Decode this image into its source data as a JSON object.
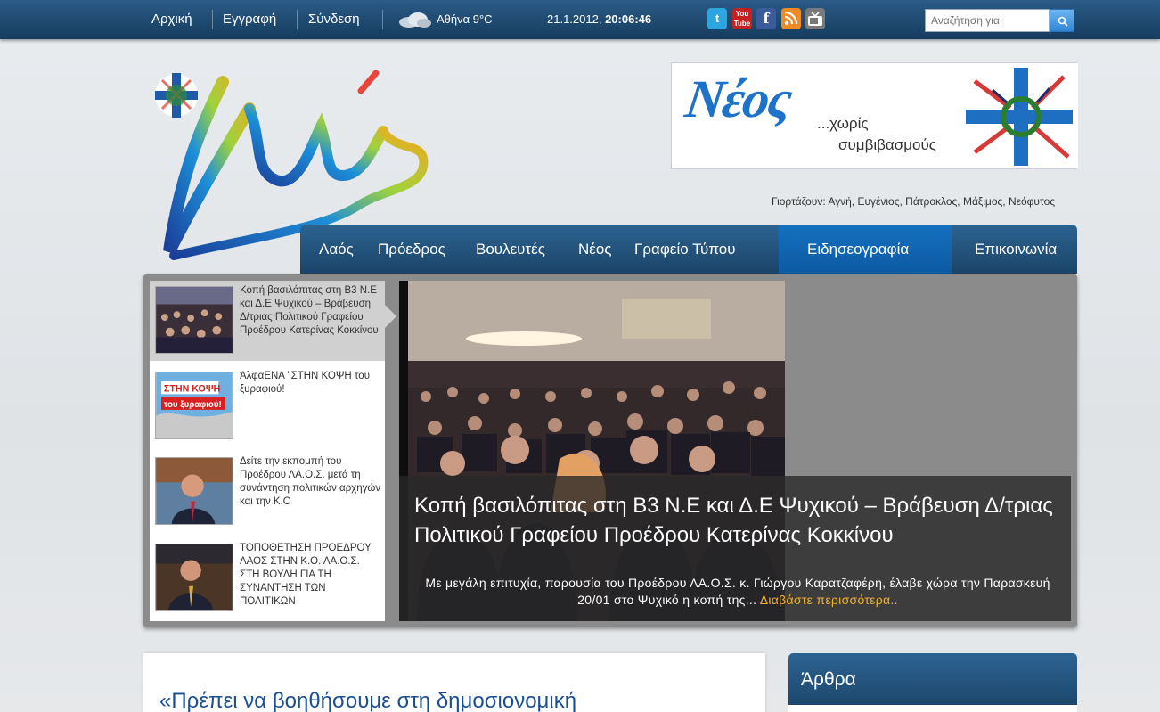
{
  "topbar": {
    "links": [
      "Αρχική",
      "Εγγραφή",
      "Σύνδεση"
    ],
    "weather": "Αθήνα 9°C",
    "date": "21.1.2012,",
    "time": "20:06:46",
    "social_icons": [
      "twitter-icon",
      "youtube-icon",
      "facebook-icon",
      "rss-icon",
      "tv-icon"
    ],
    "search_placeholder": "Αναζήτηση για:"
  },
  "banner": {
    "brand": "Νέος",
    "line1": "...χωρίς",
    "line2": "συμβιβασμούς"
  },
  "namedays": "Γιορτάζουν: Αγνή, Ευγένιος, Πάτροκλος, Μάξιμος, Νεόφυτος",
  "nav": {
    "items": [
      "Λαός",
      "Πρόεδρος",
      "Βουλευτές",
      "Νέος",
      "Γραφείο Τύπου",
      "Ειδησεογραφία",
      "Επικοινωνία"
    ],
    "active": "Ειδησεογραφία"
  },
  "slider": {
    "items": [
      {
        "title": "Κοπή βασιλόπιτας στη Β3 Ν.Ε και Δ.Ε Ψυχικού – Βράβευση Δ/τριας Πολιτικού Γραφείου Προέδρου Κατερίνας Κοκκίνου"
      },
      {
        "title": "ΆλφαΕΝΑ \"ΣΤΗΝ ΚΟΨΗ του ξυραφιού!"
      },
      {
        "title": "Δείτε την εκπομπή του Προέδρου ΛΑ.Ο.Σ. μετά τη συνάντηση πολιτικών αρχηγών και την Κ.Ο"
      },
      {
        "title": "ΤΟΠΟΘΕΤΗΣΗ ΠΡΟΕΔΡΟΥ ΛΑΟΣ ΣΤΗΝ Κ.Ο. ΛΑ.Ο.Σ. ΣΤΗ ΒΟΥΛΗ ΓΙΑ ΤΗ ΣΥΝΑΝΤΗΣΗ ΤΩΝ ΠΟΛΙΤΙΚΩΝ"
      }
    ],
    "thumb2_text": [
      "ΣΤΗΝ ΚΟΨΗ",
      "του ξυραφιού!"
    ],
    "caption_title": "Κοπή βασιλόπιτας στη Β3 Ν.Ε και Δ.Ε Ψυχικού – Βράβευση Δ/τριας Πολιτικού Γραφείου Προέδρου Κατερίνας Κοκκίνου",
    "caption_desc": "Με μεγάλη επιτυχία, παρουσία του Προέδρου ΛΑ.Ο.Σ. κ. Γιώργου Καρατζαφέρη, έλαβε χώρα την Παρασκευή 20/01 στο Ψυχικό η κοπή της...",
    "read_more": "Διαβάστε περισσότερα.."
  },
  "article": {
    "title": "«Πρέπει να βοηθήσουμε στη δημοσιονομική"
  },
  "sidebar": {
    "title": "Άρθρα"
  },
  "colors": {
    "navy": "#1a4468",
    "active_tab": "#0d5aa2",
    "link_blue": "#1b4f94",
    "accent": "#f5b12e"
  }
}
